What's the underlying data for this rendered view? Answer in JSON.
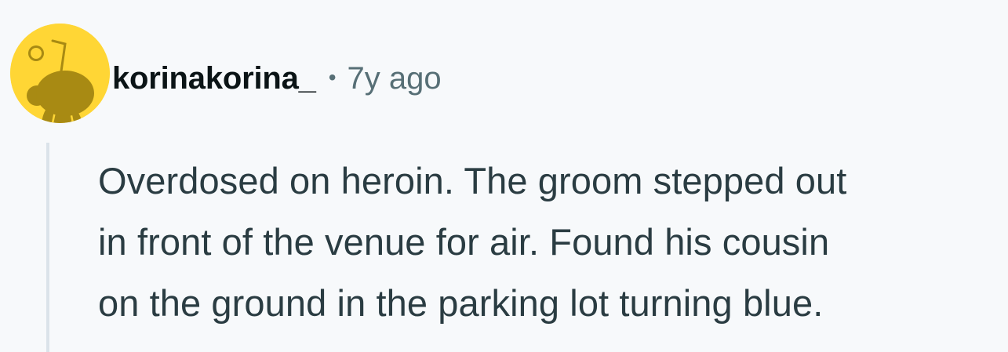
{
  "comment": {
    "author": "korinakorina_",
    "separator": "•",
    "timestamp": "7y ago",
    "avatar_icon": "snoo-avatar-icon",
    "body_lines": [
      "Overdosed on heroin. The groom stepped out",
      "in front of the venue for air. Found his cousin",
      "on the ground in the parking lot turning blue."
    ]
  },
  "colors": {
    "background": "#f7f9fb",
    "avatar_bg": "#ffd635",
    "avatar_figure": "#a88a13",
    "username": "#0b1416",
    "meta": "#576f76",
    "body": "#2a3c42",
    "thread_line": "#dbe3ea"
  }
}
